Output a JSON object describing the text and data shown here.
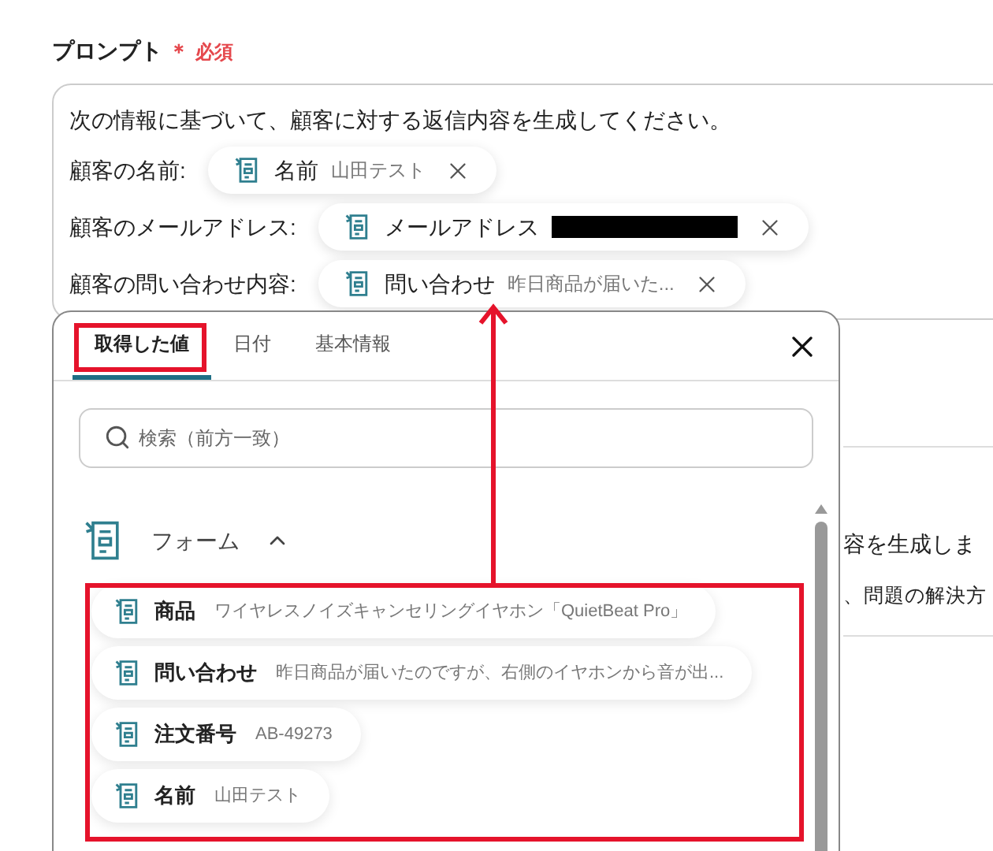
{
  "field": {
    "label": "プロンプト",
    "required_mark": "＊",
    "required_text": "必須"
  },
  "prompt": {
    "intro": "次の情報に基づいて、顧客に対する返信内容を生成してください。",
    "lines": [
      {
        "label": "顧客の名前:",
        "chip": {
          "name": "名前",
          "value": "山田テスト",
          "redacted": false
        }
      },
      {
        "label": "顧客のメールアドレス:",
        "chip": {
          "name": "メールアドレス",
          "redacted": true
        }
      },
      {
        "label": "顧客の問い合わせ内容:",
        "chip": {
          "name": "問い合わせ",
          "value": "昨日商品が届いた...",
          "redacted": false
        }
      }
    ]
  },
  "background_text": [
    "容を生成しま",
    "、問題の解決方"
  ],
  "popup": {
    "tabs": [
      {
        "label": "取得した値",
        "selected": true
      },
      {
        "label": "日付",
        "selected": false
      },
      {
        "label": "基本情報",
        "selected": false
      }
    ],
    "search": {
      "placeholder": "検索（前方一致）"
    },
    "section": {
      "title": "フォーム",
      "expanded": true
    },
    "items": [
      {
        "name": "商品",
        "value": "ワイヤレスノイズキャンセリングイヤホン「QuietBeat Pro」"
      },
      {
        "name": "問い合わせ",
        "value": "昨日商品が届いたのですが、右側のイヤホンから音が出..."
      },
      {
        "name": "注文番号",
        "value": "AB-49273"
      },
      {
        "name": "名前",
        "value": "山田テスト"
      }
    ]
  }
}
